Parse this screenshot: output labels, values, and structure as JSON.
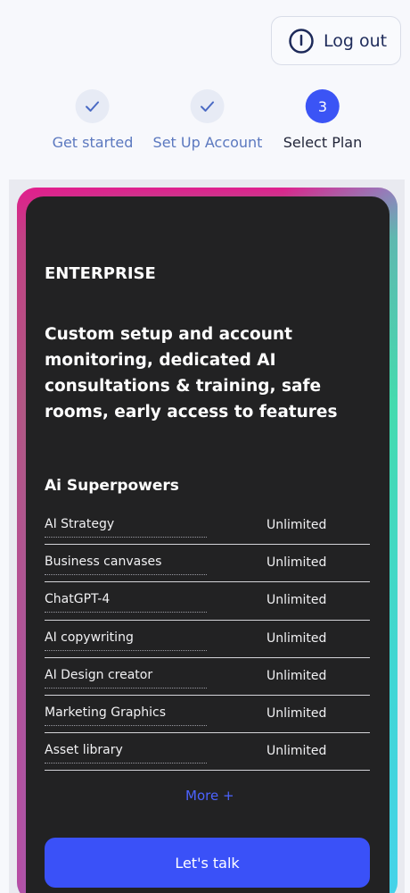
{
  "header": {
    "logout_label": "Log out",
    "logout_icon": "power-icon"
  },
  "stepper": {
    "steps": [
      {
        "label": "Get started",
        "state": "done"
      },
      {
        "label": "Set Up Account",
        "state": "done"
      },
      {
        "label": "Select Plan",
        "state": "active",
        "number": "3"
      }
    ]
  },
  "plan": {
    "name": "ENTERPRISE",
    "description": "Custom setup and account monitoring, dedicated AI consultations & training, safe rooms, early access to features",
    "features_title": "Ai Superpowers",
    "features": [
      {
        "name": "AI Strategy",
        "value": "Unlimited"
      },
      {
        "name": "Business canvases",
        "value": "Unlimited"
      },
      {
        "name": "ChatGPT-4",
        "value": "Unlimited"
      },
      {
        "name": "AI copywriting",
        "value": "Unlimited"
      },
      {
        "name": "AI Design creator",
        "value": "Unlimited"
      },
      {
        "name": "Marketing Graphics",
        "value": "Unlimited"
      },
      {
        "name": "Asset library",
        "value": "Unlimited"
      }
    ],
    "more_label": "More +",
    "cta_label": "Let's talk"
  },
  "colors": {
    "accent": "#3a51f8",
    "card_bg": "#222223",
    "step_done_text": "#5b78bf"
  }
}
